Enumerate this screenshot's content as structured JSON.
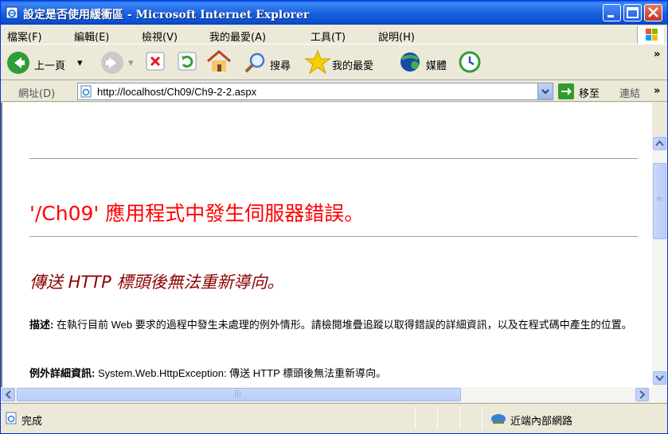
{
  "window": {
    "title": "設定是否使用緩衝區 - Microsoft Internet Explorer"
  },
  "menu": [
    "檔案(F)",
    "編輯(E)",
    "檢視(V)",
    "我的最愛(A)",
    "工具(T)",
    "說明(H)"
  ],
  "toolbar": {
    "back_label": "上一頁",
    "search_label": "搜尋",
    "favorites_label": "我的最愛",
    "media_label": "媒體",
    "more": "»"
  },
  "address": {
    "label": "網址(D)",
    "url": "http://localhost/Ch09/Ch9-2-2.aspx",
    "go_label": "移至",
    "links_label": "連結",
    "more": "»"
  },
  "page": {
    "error_title": "'/Ch09' 應用程式中發生伺服器錯誤。",
    "error_subtitle": "傳送 HTTP 標頭後無法重新導向。",
    "description_label": "描述:",
    "description_text": "在執行目前 Web 要求的過程中發生未處理的例外情形。請檢閱堆疊追蹤以取得錯誤的詳細資訊，以及在程式碼中產生的位置。",
    "exception_label": "例外詳細資訊:",
    "exception_text": "System.Web.HttpException: 傳送 HTTP 標頭後無法重新導向。"
  },
  "status": {
    "text": "完成",
    "zone": "近端內部網路"
  },
  "colors": {
    "titlebar": "#0a5fe8",
    "error_title": "#ff0000",
    "error_subtitle": "#8b0000"
  }
}
